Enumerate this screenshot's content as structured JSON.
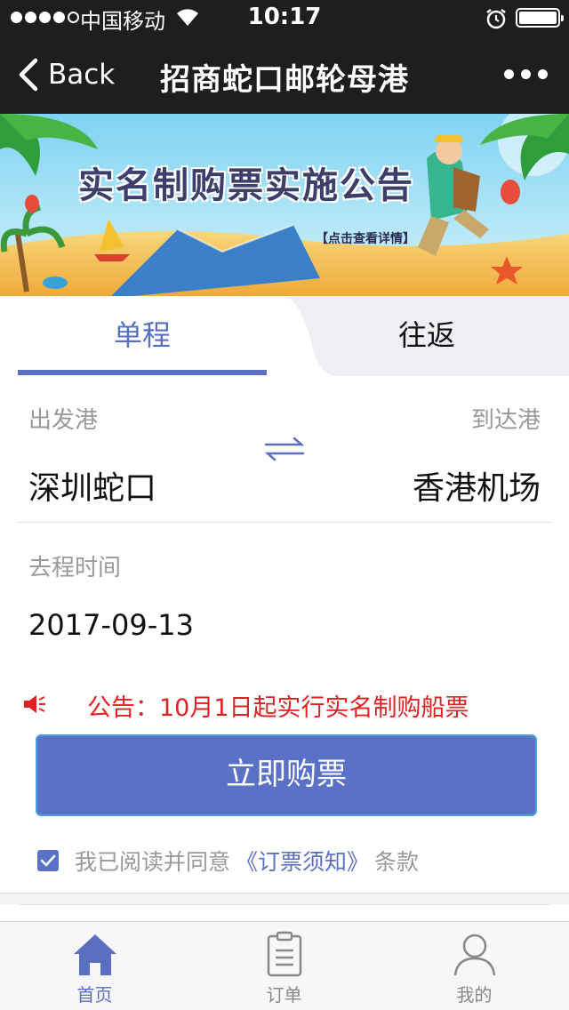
{
  "status_bar": {
    "carrier": "中国移动",
    "time": "10:17",
    "signal_bars": 4,
    "signal_total": 5,
    "battery_level": 1.0
  },
  "nav": {
    "back_label": "Back",
    "title": "招商蛇口邮轮母港",
    "more_icon": "more-dots-icon"
  },
  "banner": {
    "title": "实名制购票实施公告",
    "subtitle": "【点击查看详情】"
  },
  "tabs": [
    {
      "label": "单程",
      "active": true
    },
    {
      "label": "往返",
      "active": false
    }
  ],
  "form": {
    "depart_label": "出发港",
    "depart_value": "深圳蛇口",
    "arrive_label": "到达港",
    "arrive_value": "香港机场",
    "date_label": "去程时间",
    "date_value": "2017-09-13"
  },
  "notice": {
    "text": "公告：10月1日起实行实名制购船票",
    "icon": "speaker-icon"
  },
  "buy_button": "立即购票",
  "agreement": {
    "checked": true,
    "prefix": "我已阅读并同意",
    "link": "《订票须知》",
    "suffix": "条款"
  },
  "tabbar": [
    {
      "label": "首页",
      "icon": "home-icon",
      "active": true
    },
    {
      "label": "订单",
      "icon": "order-icon",
      "active": false
    },
    {
      "label": "我的",
      "icon": "user-icon",
      "active": false
    }
  ],
  "colors": {
    "accent": "#5b6fc1",
    "button": "#5b71c6",
    "notice": "#e02222",
    "topbar": "#1e1e20"
  }
}
